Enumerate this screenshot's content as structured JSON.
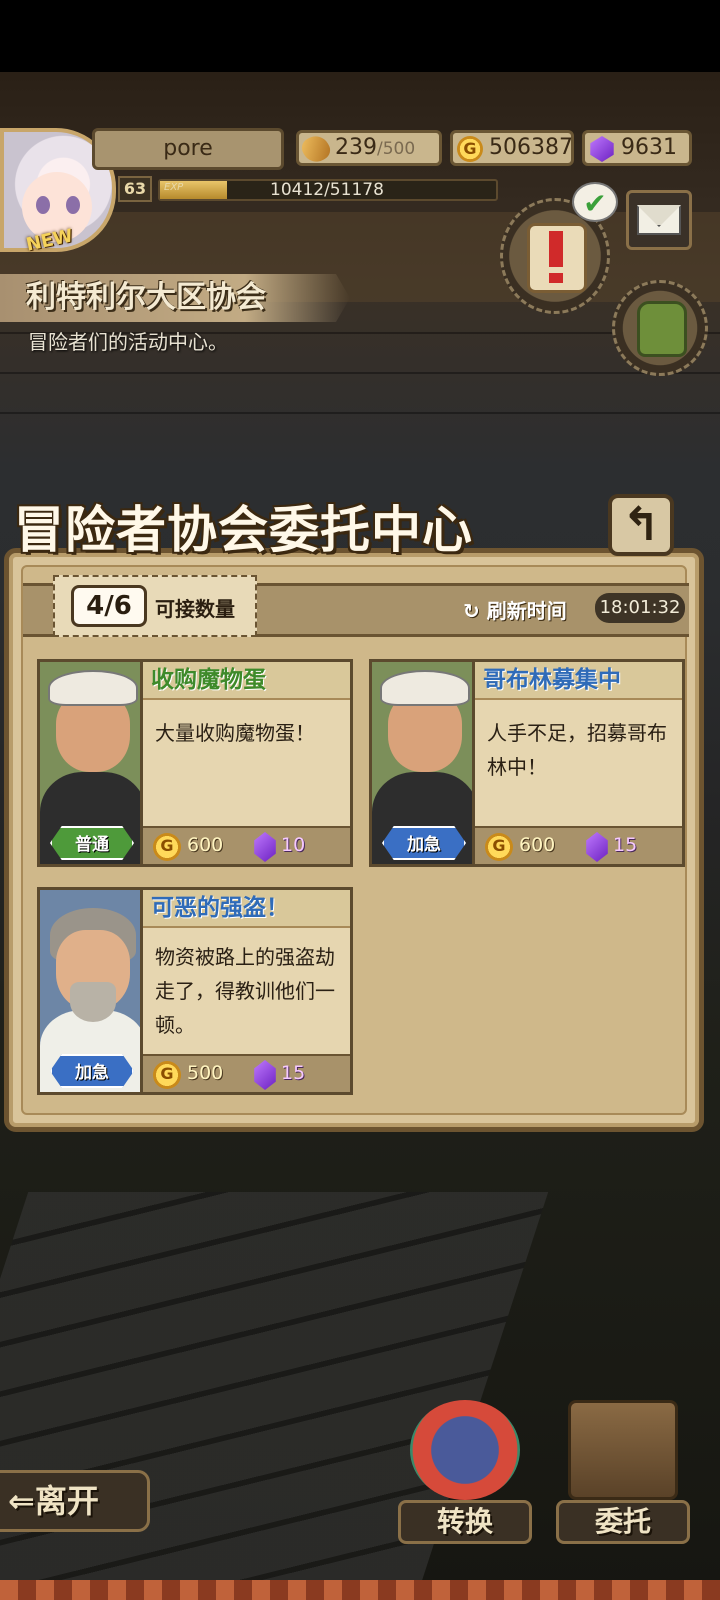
{
  "player": {
    "name": "pore",
    "level": "63",
    "new_badge": "NEW",
    "exp_label": "EXP",
    "exp_text": "10412/51178",
    "exp_fraction": 0.2
  },
  "resources": {
    "stamina": "239",
    "stamina_max": "/500",
    "gold": "506387",
    "gems": "9631",
    "coin_symbol": "G"
  },
  "location": {
    "title": "利特利尔大区协会",
    "subtitle": "冒险者们的活动中心。"
  },
  "panel": {
    "title": "冒险者协会委托中心",
    "back_symbol": "↰",
    "count": "4/6",
    "count_label": "可接数量",
    "refresh_label": "↻ 刷新时间",
    "refresh_time": "18:01:32"
  },
  "quests": [
    {
      "title": "收购魔物蛋",
      "desc": "大量收购魔物蛋！",
      "tag": "普通",
      "gold": "600",
      "gems": "10"
    },
    {
      "title": "哥布林募集中",
      "desc": "人手不足，招募哥布林中！",
      "tag": "加急",
      "gold": "600",
      "gems": "15"
    },
    {
      "title": "可恶的强盗！",
      "desc": "物资被路上的强盗劫走了，得教训他们一顿。",
      "tag": "加急",
      "gold": "500",
      "gems": "15"
    }
  ],
  "bottom": {
    "leave": "⇐离开",
    "convert": "转换",
    "commission": "委托"
  },
  "icons": {
    "mail": "envelope-icon",
    "quest": "quest-scroll-icon",
    "bag": "backpack-icon",
    "check": "✔"
  },
  "colors": {
    "normal_tag": "#4e9a3a",
    "urgent_tag": "#3a6fc4",
    "title_green": "#3e8a2a",
    "title_blue": "#2f6bb8"
  }
}
